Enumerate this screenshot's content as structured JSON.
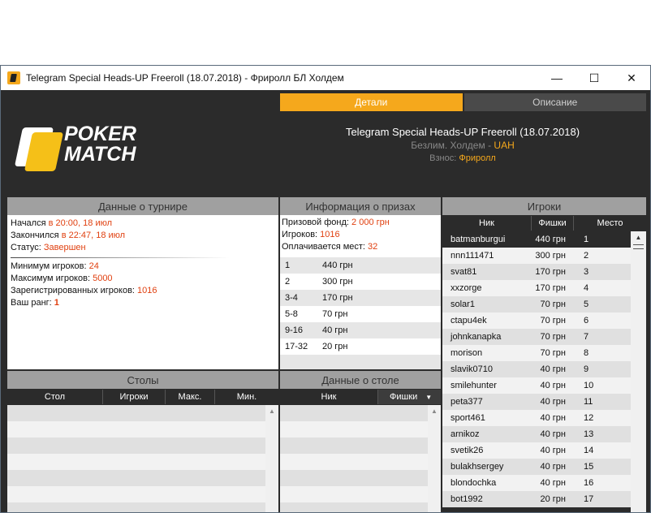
{
  "window": {
    "title": "Telegram Special Heads-UP Freeroll (18.07.2018) - Фриролл БЛ Холдем",
    "minimize": "—",
    "maximize": "☐",
    "close": "✕"
  },
  "tabs": {
    "details": "Детали",
    "description": "Описание"
  },
  "logo": {
    "line1": "POKER",
    "line2": "MATCH"
  },
  "tournament": {
    "name": "Telegram Special Heads-UP Freeroll (18.07.2018)",
    "game": "Безлим. Холдем - ",
    "currency": "UAH",
    "buyin_label": "Взнос: ",
    "buyin_value": "Фриролл"
  },
  "tournament_data": {
    "title": "Данные о турнире",
    "started_label": "Начался ",
    "started_value": "в 20:00, 18 июл",
    "ended_label": "Закончился ",
    "ended_value": "в 22:47, 18 июл",
    "status_label": "Статус: ",
    "status_value": "Завершен",
    "min_label": "Минимум игроков: ",
    "min_value": "24",
    "max_label": "Максимум игроков: ",
    "max_value": "5000",
    "reg_label": "Зарегистрированных игроков: ",
    "reg_value": "1016",
    "rank_label": "Ваш ранг: ",
    "rank_value": "1"
  },
  "prize_info": {
    "title": "Информация о призах",
    "fund_label": "Призовой фонд: ",
    "fund_value": "2 000 грн",
    "players_label": "Игроков: ",
    "players_value": "1016",
    "paid_label": "Оплачивается мест: ",
    "paid_value": "32",
    "rows": [
      {
        "place": "1",
        "prize": "440 грн"
      },
      {
        "place": "2",
        "prize": "300 грн"
      },
      {
        "place": "3-4",
        "prize": "170 грн"
      },
      {
        "place": "5-8",
        "prize": "70 грн"
      },
      {
        "place": "9-16",
        "prize": "40 грн"
      },
      {
        "place": "17-32",
        "prize": "20 грн"
      }
    ]
  },
  "tables": {
    "title": "Столы",
    "cols": [
      "Стол",
      "Игроки",
      "Макс.",
      "Мин."
    ]
  },
  "table_data": {
    "title": "Данные о столе",
    "cols": [
      "Ник",
      "Фишки"
    ]
  },
  "players": {
    "title": "Игроки",
    "cols": [
      "Ник",
      "Фишки",
      "Место"
    ],
    "rows": [
      {
        "nick": "batmanburgui",
        "chips": "440 грн",
        "place": "1"
      },
      {
        "nick": "nnn111471",
        "chips": "300 грн",
        "place": "2"
      },
      {
        "nick": "svat81",
        "chips": "170 грн",
        "place": "3"
      },
      {
        "nick": "xxzorge",
        "chips": "170 грн",
        "place": "4"
      },
      {
        "nick": "solar1",
        "chips": "70 грн",
        "place": "5"
      },
      {
        "nick": "ctapu4ek",
        "chips": "70 грн",
        "place": "6"
      },
      {
        "nick": "johnkanapka",
        "chips": "70 грн",
        "place": "7"
      },
      {
        "nick": "morison",
        "chips": "70 грн",
        "place": "8"
      },
      {
        "nick": "slavik0710",
        "chips": "40 грн",
        "place": "9"
      },
      {
        "nick": "smilehunter",
        "chips": "40 грн",
        "place": "10"
      },
      {
        "nick": "peta377",
        "chips": "40 грн",
        "place": "11"
      },
      {
        "nick": "sport461",
        "chips": "40 грн",
        "place": "12"
      },
      {
        "nick": "arnikoz",
        "chips": "40 грн",
        "place": "13"
      },
      {
        "nick": "svetik26",
        "chips": "40 грн",
        "place": "14"
      },
      {
        "nick": "bulakhsergey",
        "chips": "40 грн",
        "place": "15"
      },
      {
        "nick": "blondochka",
        "chips": "40 грн",
        "place": "16"
      },
      {
        "nick": "bot1992",
        "chips": "20 грн",
        "place": "17"
      }
    ]
  },
  "colors": {
    "accent": "#f5a81c",
    "highlight": "#e04010",
    "selected_row": "#2b2b2b"
  }
}
